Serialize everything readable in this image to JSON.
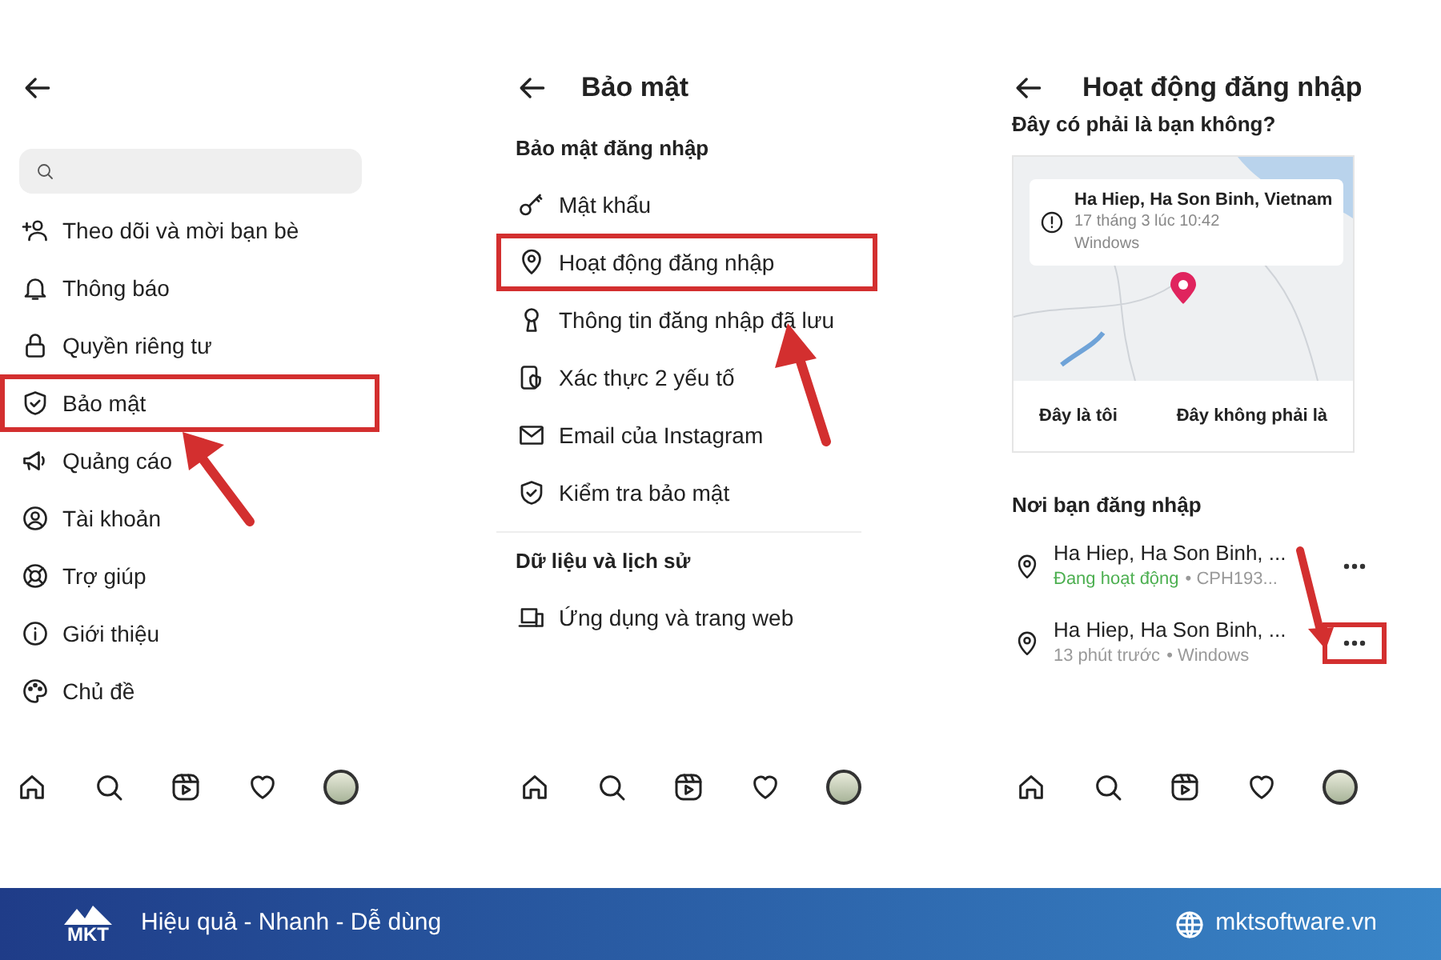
{
  "screens": [
    {
      "kind": "settings",
      "items": [
        {
          "label": "Theo dõi và mời bạn bè",
          "highlighted": false
        },
        {
          "label": "Thông báo",
          "highlighted": false
        },
        {
          "label": "Quyền riêng tư",
          "highlighted": false
        },
        {
          "label": "Bảo mật",
          "highlighted": true
        },
        {
          "label": "Quảng cáo",
          "highlighted": false
        },
        {
          "label": "Tài khoản",
          "highlighted": false
        },
        {
          "label": "Trợ giúp",
          "highlighted": false
        },
        {
          "label": "Giới thiệu",
          "highlighted": false
        },
        {
          "label": "Chủ đề",
          "highlighted": false
        }
      ]
    },
    {
      "kind": "security",
      "title": "Bảo mật",
      "sections": [
        {
          "heading": "Bảo mật đăng nhập",
          "items": [
            {
              "label": "Mật khẩu",
              "highlighted": false
            },
            {
              "label": "Hoạt động đăng nhập",
              "highlighted": true
            },
            {
              "label": "Thông tin đăng nhập đã lưu",
              "highlighted": false
            },
            {
              "label": "Xác thực 2 yếu tố",
              "highlighted": false
            },
            {
              "label": "Email của Instagram",
              "highlighted": false
            },
            {
              "label": "Kiểm tra bảo mật",
              "highlighted": false
            }
          ]
        },
        {
          "heading": "Dữ liệu và lịch sử",
          "items": [
            {
              "label": "Ứng dụng và trang web",
              "highlighted": false
            }
          ]
        }
      ]
    },
    {
      "kind": "login_activity",
      "title": "Hoạt động đăng nhập",
      "question": "Đây có phải là bạn không?",
      "alert": {
        "place": "Ha Hiep, Ha Son Binh, Vietnam",
        "time": "17 tháng 3 lúc 10:42",
        "device": "Windows"
      },
      "actions": [
        "Đây là tôi",
        "Đây không phải là"
      ],
      "sessions_heading": "Nơi bạn đăng nhập",
      "sessions": [
        {
          "place": "Ha Hiep, Ha Son Binh, ...",
          "status": "Đang hoạt động",
          "detail": "• CPH193...",
          "active": true,
          "menu_highlighted": false
        },
        {
          "place": "Ha Hiep, Ha Son Binh, ...",
          "status": "13 phút trước",
          "detail": "• Windows",
          "active": false,
          "menu_highlighted": true
        }
      ]
    }
  ],
  "footer": {
    "logo": "MKT",
    "tagline": "Hiệu quả - Nhanh - Dễ dùng",
    "url": "mktsoftware.vn"
  }
}
